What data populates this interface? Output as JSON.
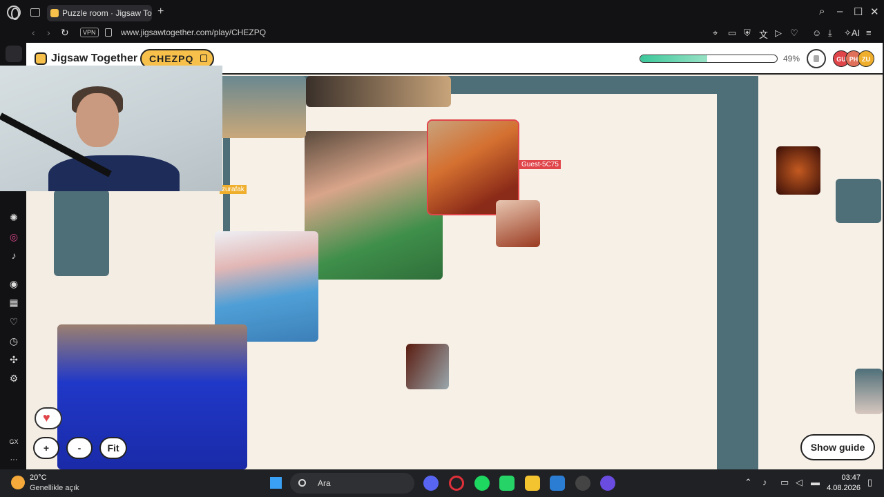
{
  "browser": {
    "tab_title": "Puzzle room · Jigsaw Together",
    "tab_add": "+",
    "url": "www.jigsawtogether.com/play/CHEZPQ",
    "vpn_label": "VPN",
    "ai_label": "AI"
  },
  "app": {
    "brand": "Jigsaw Together",
    "room_code": "CHEZPQ",
    "progress_percent": 49,
    "progress_label": "49%",
    "avatars": [
      {
        "initials": "GU",
        "color": "#e0454a"
      },
      {
        "initials": "PH",
        "color": "#e0705a"
      },
      {
        "initials": "ZU",
        "color": "#efae2c"
      }
    ],
    "cursor_labels": [
      {
        "text": "Guest-5C75",
        "color": "#e0454a"
      },
      {
        "text": "zurafak",
        "color": "#efae2c"
      }
    ],
    "zoom_in_label": "+",
    "zoom_out_label": "-",
    "fit_label": "Fit",
    "show_guide_label": "Show guide"
  },
  "sidebar": {
    "gx_label": "GX",
    "more_label": "···"
  },
  "taskbar": {
    "temperature": "20°C",
    "weather": "Genellikle açık",
    "search_placeholder": "Ara",
    "time": "03:47",
    "date": "4.08.2026"
  },
  "colors": {
    "accent_yellow": "#f6c04a",
    "board_teal": "#4f6f78",
    "progress_green": "#3cc79a"
  }
}
